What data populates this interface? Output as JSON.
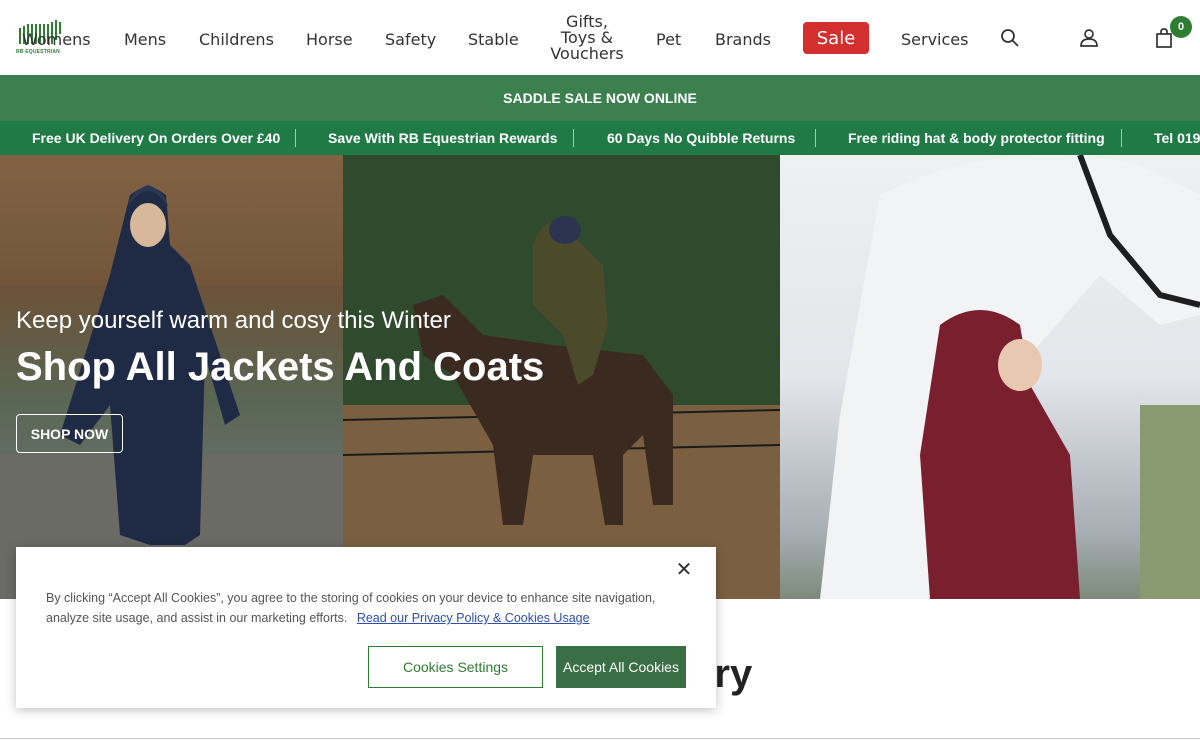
{
  "header": {
    "logo_text": "RB EQUESTRIAN",
    "nav": [
      "Womens",
      "Mens",
      "Childrens",
      "Horse",
      "Safety",
      "Stable"
    ],
    "gifts_lines": [
      "Gifts,",
      "Toys &",
      "Vouchers"
    ],
    "nav2": [
      "Pet",
      "Brands"
    ],
    "sale": "Sale",
    "services": "Services",
    "cart_count": "0"
  },
  "banner": {
    "text": "SADDLE SALE NOW ONLINE"
  },
  "usps": [
    "Free UK Delivery On Orders Over £40",
    "Save With RB Equestrian Rewards",
    "60 Days No Quibble Returns",
    "Free riding hat & body protector fitting",
    "Tel 019"
  ],
  "hero": {
    "subtitle": "Keep yourself warm and cosy this Winter",
    "title": "Shop All Jackets And Coats",
    "cta": "SHOP NOW"
  },
  "section": {
    "heading_partial": "ory"
  },
  "cookie": {
    "text": "By clicking “Accept All Cookies”, you agree to the storing of cookies on your device to enhance site navigation, analyze site usage, and assist in our marketing efforts.",
    "link": "Read our Privacy Policy & Cookies Usage",
    "settings_label": "Cookies Settings",
    "accept_label": "Accept All Cookies",
    "close": "✕"
  },
  "colors": {
    "brand_green": "#2e7d32",
    "sale_red": "#d32f2f",
    "banner_green": "#3d8050",
    "strip_green": "#1f7a45"
  }
}
